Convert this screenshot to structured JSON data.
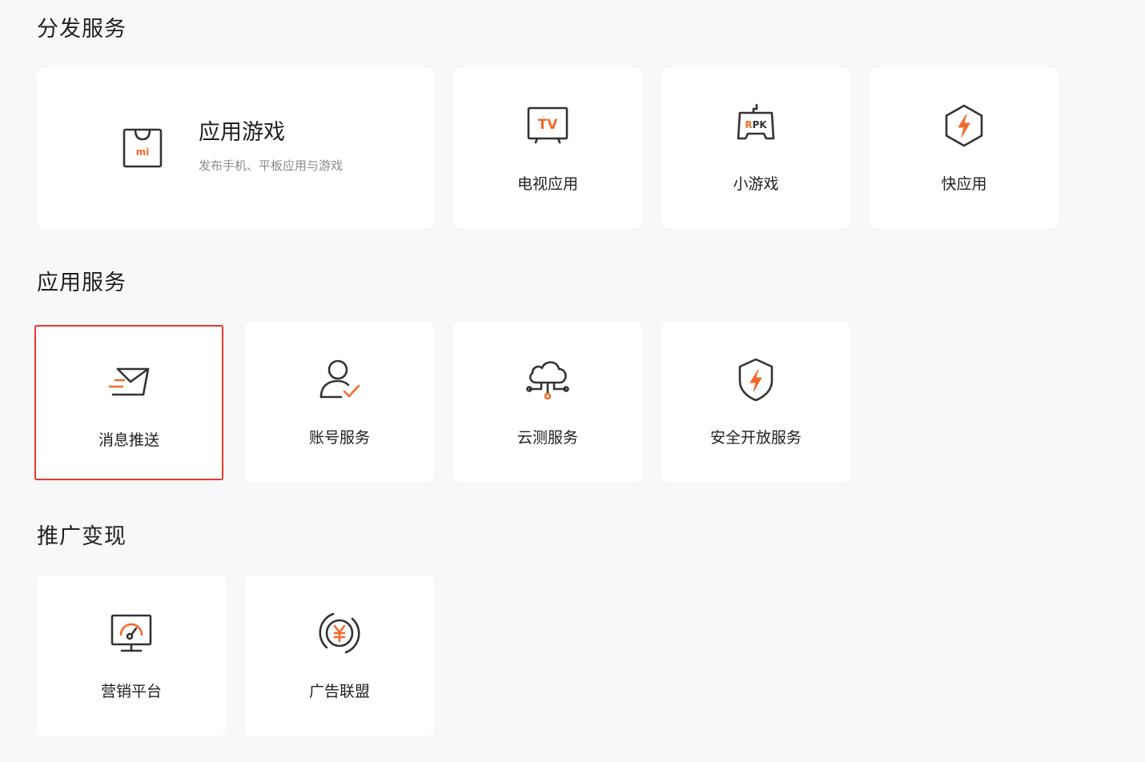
{
  "sections": [
    {
      "title": "分发服务",
      "featured": {
        "title": "应用游戏",
        "desc": "发布手机、平板应用与游戏",
        "icon": "mi-bag-icon"
      },
      "items": [
        {
          "label": "电视应用",
          "icon": "tv-icon"
        },
        {
          "label": "小游戏",
          "icon": "rpk-gamepad-icon"
        },
        {
          "label": "快应用",
          "icon": "lightning-hexagon-icon"
        }
      ]
    },
    {
      "title": "应用服务",
      "items": [
        {
          "label": "消息推送",
          "icon": "envelope-send-icon",
          "selected": true
        },
        {
          "label": "账号服务",
          "icon": "user-check-icon"
        },
        {
          "label": "云测服务",
          "icon": "cloud-network-icon"
        },
        {
          "label": "安全开放服务",
          "icon": "shield-lightning-icon"
        }
      ]
    },
    {
      "title": "推广变现",
      "items": [
        {
          "label": "营销平台",
          "icon": "monitor-gauge-icon"
        },
        {
          "label": "广告联盟",
          "icon": "yuan-circle-icon"
        }
      ]
    }
  ],
  "colors": {
    "accent": "#f26a2a",
    "icon_stroke": "#333333",
    "selected_border": "#e8382a",
    "background": "#f7f8fa",
    "card": "#ffffff"
  }
}
